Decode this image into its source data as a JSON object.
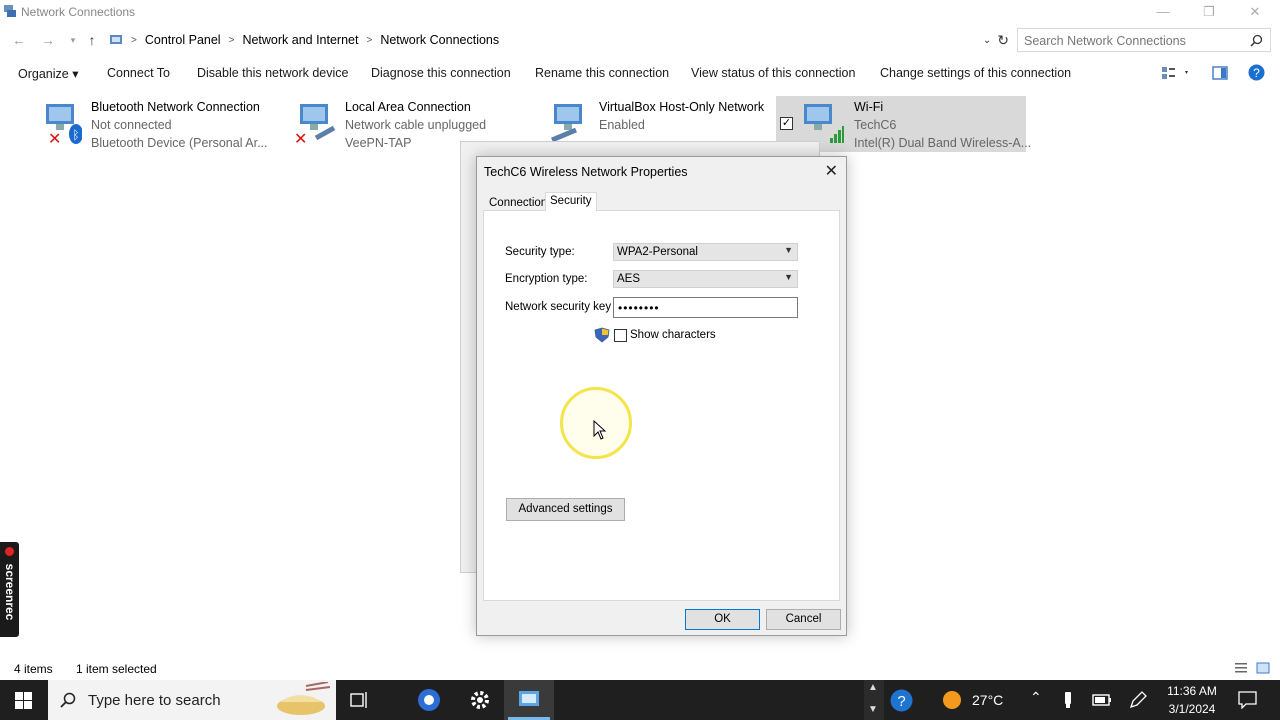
{
  "window": {
    "title": "Network Connections",
    "minimize": "—",
    "restore": "❐",
    "close": "✕"
  },
  "address": {
    "crumbs": [
      "Control Panel",
      "Network and Internet",
      "Network Connections"
    ],
    "search_placeholder": "Search Network Connections"
  },
  "commands": [
    "Organize ▾",
    "Connect To",
    "Disable this network device",
    "Diagnose this connection",
    "Rename this connection",
    "View status of this connection",
    "Change settings of this connection"
  ],
  "items": [
    {
      "name": "Bluetooth Network Connection",
      "status": "Not connected",
      "device": "Bluetooth Device (Personal Ar..."
    },
    {
      "name": "Local Area Connection",
      "status": "Network cable unplugged",
      "device": "VeePN-TAP"
    },
    {
      "name": "VirtualBox Host-Only Network",
      "status": "Enabled",
      "device": ""
    },
    {
      "name": "Wi-Fi",
      "status": "TechC6",
      "device": "Intel(R) Dual Band Wireless-A..."
    }
  ],
  "dialog": {
    "title": "TechC6 Wireless Network Properties",
    "tabs": [
      "Connection",
      "Security"
    ],
    "security_type_label": "Security type:",
    "security_type_value": "WPA2-Personal",
    "encryption_type_label": "Encryption type:",
    "encryption_type_value": "AES",
    "key_label": "Network security key",
    "key_value": "••••••••",
    "show_characters": "Show characters",
    "advanced_button": "Advanced settings",
    "ok": "OK",
    "cancel": "Cancel"
  },
  "statusbar": {
    "items_count": "4 items",
    "selected": "1 item selected"
  },
  "taskbar": {
    "search_placeholder": "Type here to search",
    "temperature": "27°C",
    "time": "11:36 AM",
    "date": "3/1/2024"
  },
  "screenrec_label": "screenrec",
  "colors": {
    "selection": "#d9d9d9",
    "accent": "#0078d7",
    "taskbar": "#1f1f1f"
  }
}
